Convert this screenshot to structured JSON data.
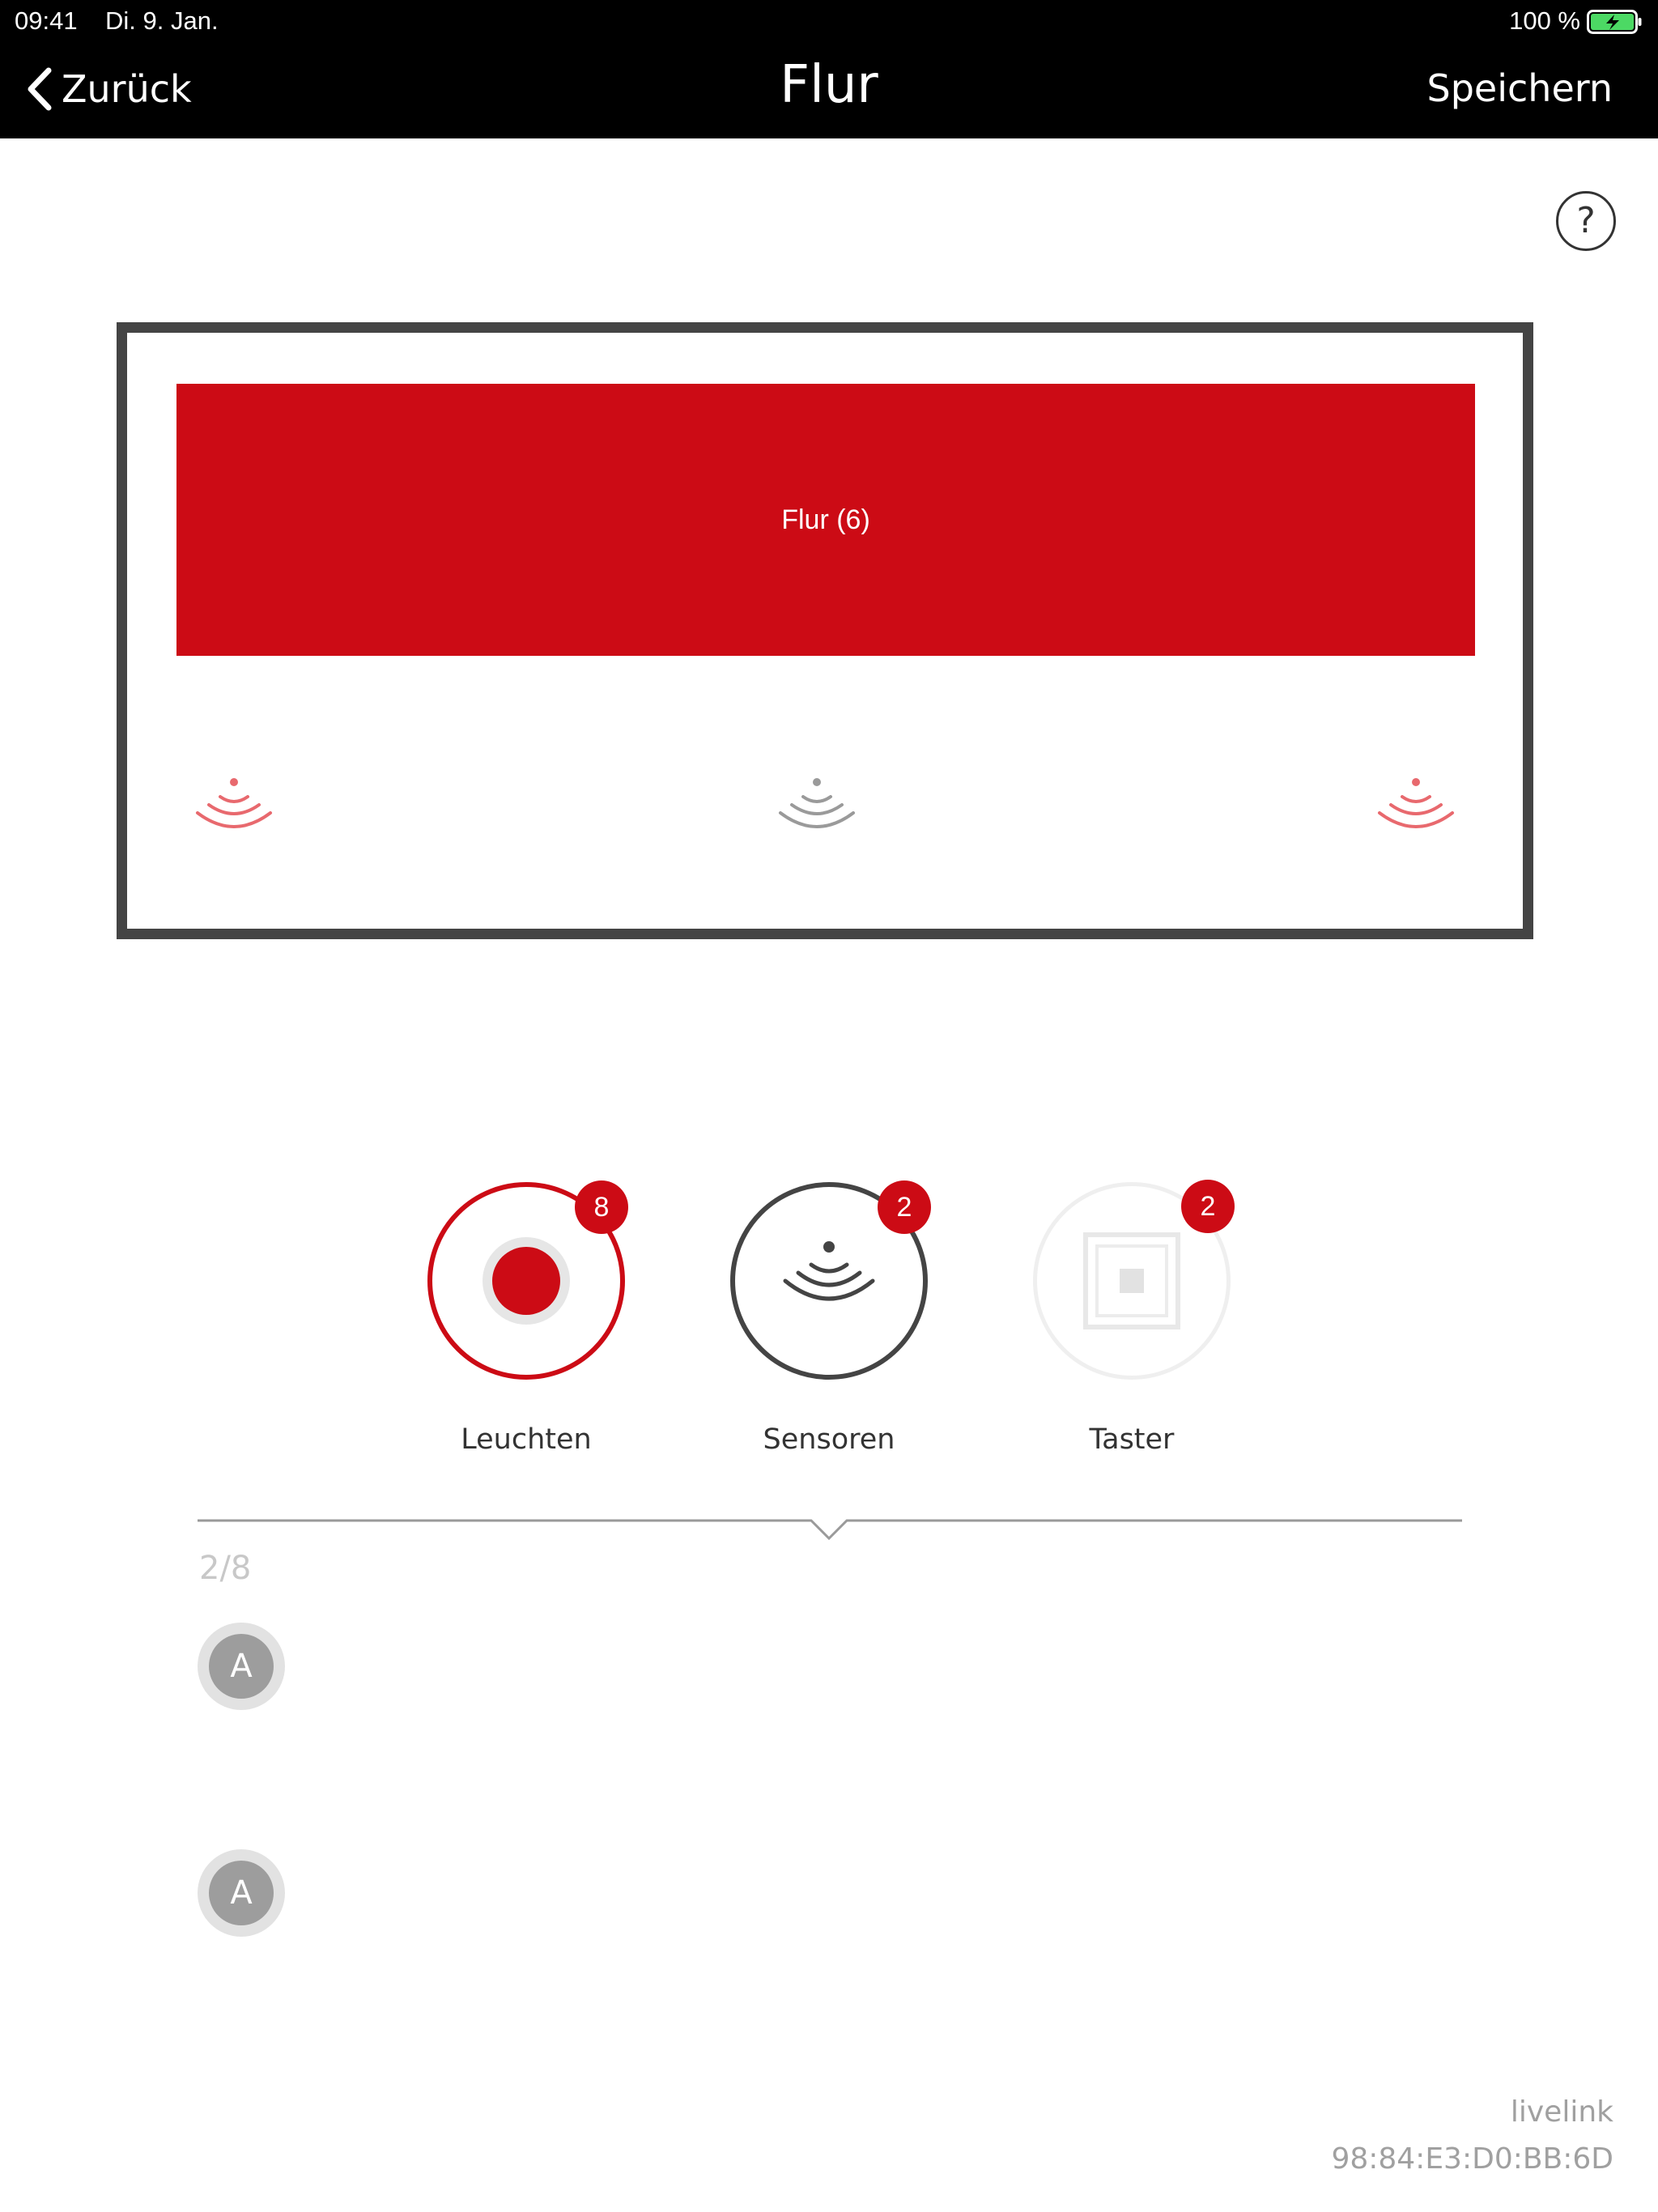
{
  "status_bar": {
    "time": "09:41",
    "date": "Di. 9. Jan.",
    "battery_text": "100 %",
    "battery_level": 1.0,
    "battery_color": "#4cd964"
  },
  "nav": {
    "back_label": "Zurück",
    "back_icon": "chevron-left-icon",
    "title": "Flur",
    "save_label": "Speichern"
  },
  "help": {
    "label": "?"
  },
  "room": {
    "zone_label": "Flur (6)",
    "zone_color": "#cc0b15",
    "frame_color": "#444444",
    "sensors": [
      {
        "name": "sensor-left",
        "color": "#e8696e",
        "icon": "signal-waves-icon"
      },
      {
        "name": "sensor-center",
        "color": "#9a9a9a",
        "icon": "signal-waves-icon"
      },
      {
        "name": "sensor-right",
        "color": "#e8696e",
        "icon": "signal-waves-icon"
      }
    ]
  },
  "categories": [
    {
      "label": "Leuchten",
      "count": "8",
      "icon": "light-icon",
      "selected": true,
      "color": "#cc0b15"
    },
    {
      "label": "Sensoren",
      "count": "2",
      "icon": "sensor-icon",
      "selected": false,
      "color": "#444444"
    },
    {
      "label": "Taster",
      "count": "2",
      "icon": "switch-icon",
      "selected": false,
      "color": "#eeeeee"
    }
  ],
  "list": {
    "counter": "2/8",
    "items": [
      {
        "avatar_letter": "A"
      },
      {
        "avatar_letter": "A"
      }
    ]
  },
  "footer": {
    "brand": "livelink",
    "mac": "98:84:E3:D0:BB:6D"
  }
}
